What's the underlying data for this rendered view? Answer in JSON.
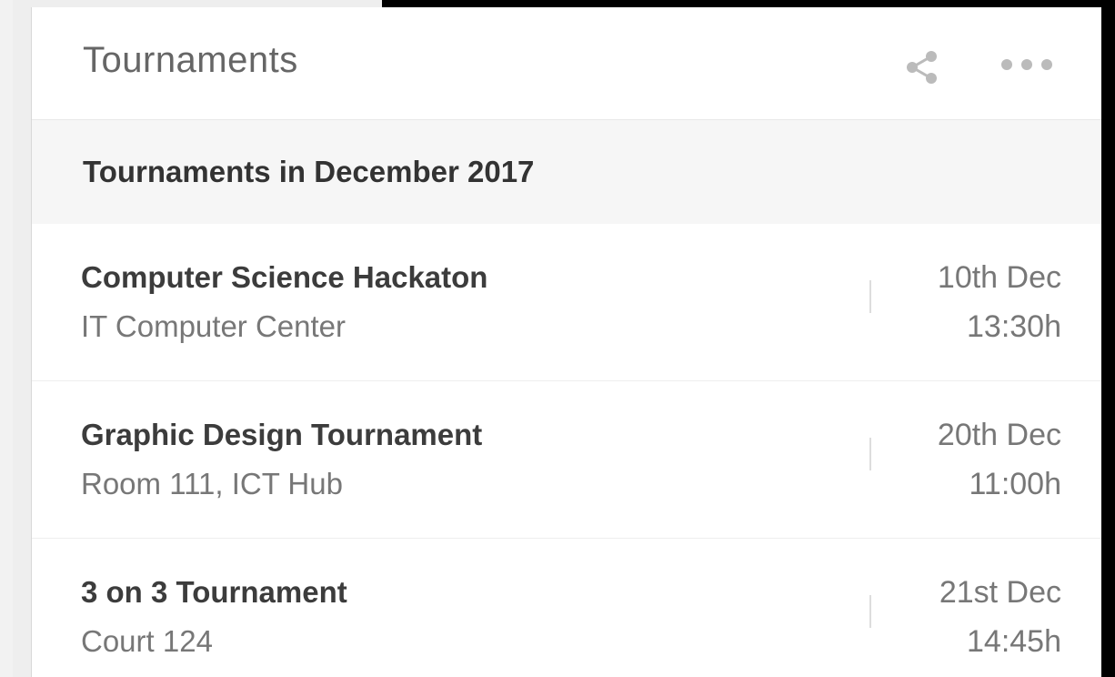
{
  "card": {
    "title": "Tournaments",
    "share_icon": "share-icon",
    "more_icon": "more-horizontal-icon"
  },
  "section": {
    "title": "Tournaments in December 2017"
  },
  "tournaments": [
    {
      "name": "Computer Science Hackaton",
      "location": "IT Computer Center",
      "date": "10th Dec",
      "time": "13:30h"
    },
    {
      "name": "Graphic Design Tournament",
      "location": "Room 111, ICT Hub",
      "date": "20th Dec",
      "time": "11:00h"
    },
    {
      "name": "3 on 3 Tournament",
      "location": "Court 124",
      "date": "21st Dec",
      "time": "14:45h"
    }
  ],
  "colors": {
    "card_background": "#ffffff",
    "section_background": "#f6f6f6",
    "icon_color": "#bbbbbb",
    "title_color": "#666666"
  }
}
